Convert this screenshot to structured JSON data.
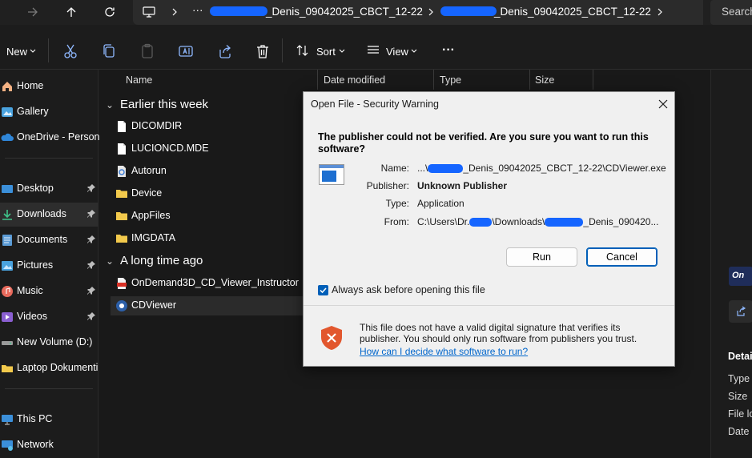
{
  "address_bar": {
    "ellipsis": "···",
    "crumb1": "_Denis_09042025_CBCT_12-22",
    "crumb2": "_Denis_09042025_CBCT_12-22",
    "search_placeholder": "Search"
  },
  "toolbar": {
    "new_label": "New",
    "sort_label": "Sort",
    "view_label": "View",
    "more_label": "···"
  },
  "sidebar": {
    "items": [
      {
        "label": "Home",
        "icon": "home-icon"
      },
      {
        "label": "Gallery",
        "icon": "gallery-icon"
      },
      {
        "label": "OneDrive - Persona",
        "icon": "onedrive-icon"
      },
      {
        "label": "Desktop",
        "icon": "desktop-icon"
      },
      {
        "label": "Downloads",
        "icon": "downloads-icon"
      },
      {
        "label": "Documents",
        "icon": "documents-icon"
      },
      {
        "label": "Pictures",
        "icon": "pictures-icon"
      },
      {
        "label": "Music",
        "icon": "music-icon"
      },
      {
        "label": "Videos",
        "icon": "videos-icon"
      },
      {
        "label": "New Volume (D:)",
        "icon": "drive-icon"
      },
      {
        "label": "Laptop Dokumenti",
        "icon": "folder-icon"
      },
      {
        "label": "This PC",
        "icon": "this-pc-icon"
      },
      {
        "label": "Network",
        "icon": "network-icon"
      }
    ]
  },
  "filelist": {
    "columns": [
      "Name",
      "Date modified",
      "Type",
      "Size"
    ],
    "groups": [
      {
        "title": "Earlier this week",
        "items": [
          "DICOMDIR",
          "LUCIONCD.MDE",
          "Autorun",
          "Device",
          "AppFiles",
          "IMGDATA"
        ]
      },
      {
        "title": "A long time ago",
        "items": [
          "OnDemand3D_CD_Viewer_Instructor",
          "CDViewer"
        ]
      }
    ]
  },
  "details_pane": {
    "heading": "Detail",
    "fields": [
      "Type",
      "Size",
      "File lo",
      "Date "
    ]
  },
  "dialog": {
    "title": "Open File - Security Warning",
    "question": "The publisher could not be verified.  Are you sure you want to run this software?",
    "name_label": "Name:",
    "name_prefix": "...\\",
    "name_value": "_Denis_09042025_CBCT_12-22\\CDViewer.exe",
    "publisher_label": "Publisher:",
    "publisher_value": "Unknown Publisher",
    "type_label": "Type:",
    "type_value": "Application",
    "from_label": "From:",
    "from_part1": "C:\\Users\\Dr.",
    "from_part2": "\\Downloads\\",
    "from_part3": "_Denis_090420...",
    "run_label": "Run",
    "cancel_label": "Cancel",
    "checkbox_label": "Always ask before opening this file",
    "checkbox_checked": true,
    "warning_text": "This file does not have a valid digital signature that verifies its publisher.  You should only run software from publishers you trust.",
    "help_link": "How can I decide what software to run?"
  },
  "colors": {
    "accent": "#005fb8",
    "folder": "#f2c94c",
    "redaction": "#1565ff",
    "shield": "#e2572e"
  }
}
